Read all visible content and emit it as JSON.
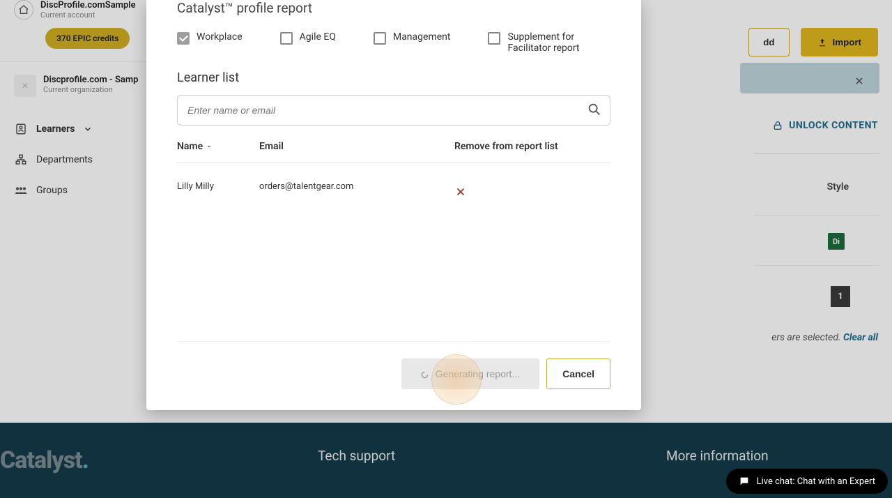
{
  "sidebar": {
    "account_name": "DiscProfile.comSample",
    "account_sub": "Current account",
    "credits": "370 EPIC credits",
    "org_name": "Discprofile.com - Samp",
    "org_sub": "Current organization",
    "nav": {
      "learners": "Learners",
      "departments": "Departments",
      "groups": "Groups"
    }
  },
  "main": {
    "add": "dd",
    "import": "Import",
    "unlock": "UNLOCK CONTENT",
    "style_col": "Style",
    "di": "Di",
    "page": "1",
    "selected_suffix": "ers are selected. ",
    "clear_all": "Clear all"
  },
  "modal": {
    "title": "Catalyst™ profile report",
    "checks": {
      "workplace": "Workplace",
      "agile": "Agile EQ",
      "management": "Management",
      "supplement": "Supplement for Facilitator report"
    },
    "learner_list": "Learner list",
    "search_placeholder": "Enter name or email",
    "cols": {
      "name": "Name",
      "email": "Email",
      "remove": "Remove from report list"
    },
    "row": {
      "name": "Lilly Milly",
      "email": "orders@talentgear.com"
    },
    "generating": "Generating report...",
    "cancel": "Cancel"
  },
  "footer": {
    "brand": "Catalyst",
    "tech": "Tech support",
    "more": "More information"
  },
  "chat": {
    "label": "Live chat:",
    "text": "Chat with an Expert"
  }
}
